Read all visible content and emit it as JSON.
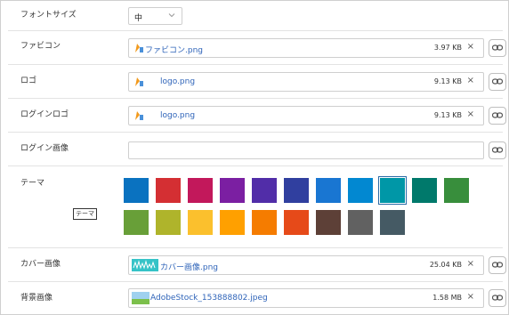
{
  "font_size": {
    "label": "フォントサイズ",
    "value": "中"
  },
  "favicon": {
    "label": "ファビコン",
    "file_name": "ファビコン.png",
    "file_size": "3.97 KB",
    "clear": "×"
  },
  "logo": {
    "label": "ロゴ",
    "file_name": "logo.png",
    "file_size": "9.13 KB",
    "clear": "×"
  },
  "login_logo": {
    "label": "ログインロゴ",
    "file_name": "logo.png",
    "file_size": "9.13 KB",
    "clear": "×"
  },
  "login_image": {
    "label": "ログイン画像"
  },
  "theme": {
    "label": "テーマ",
    "tooltip": "テーマ",
    "colors": [
      "#0a72c0",
      "#d42f33",
      "#c2185b",
      "#7b1fa2",
      "#512da8",
      "#303f9f",
      "#1976d2",
      "#0288d1",
      "#0097a7",
      "#00796b",
      "#388e3c",
      "#689f38",
      "#afb42b",
      "#fbc02d",
      "#ffa000",
      "#f57c00",
      "#e64a19",
      "#5d4037",
      "#616161",
      "#455a64"
    ],
    "selected_index": 8
  },
  "cover_image": {
    "label": "カバー画像",
    "file_name": "カバー画像.png",
    "file_size": "25.04 KB",
    "clear": "×"
  },
  "background_image": {
    "label": "背景画像",
    "file_name": "AdobeStock_153888802.jpeg",
    "file_size": "1.58 MB",
    "clear": "×"
  }
}
